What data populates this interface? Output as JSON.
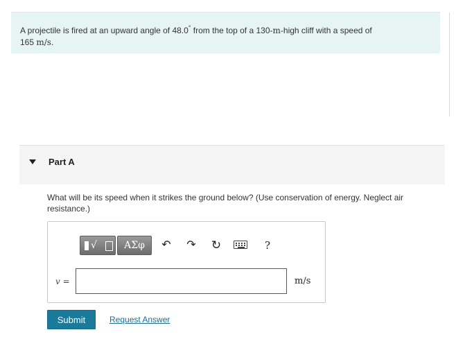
{
  "problem": {
    "text_1": "A projectile is fired at an upward angle of 48.0",
    "degree": "°",
    "text_2": " from the top of a 130-",
    "unit_m": "m",
    "text_3": "-high cliff with a speed of",
    "speed_value": "165",
    "speed_unit": "m/s",
    "end": "."
  },
  "part": {
    "title": "Part A",
    "question": "What will be its speed when it strikes the ground below? (Use conservation of energy. Neglect air resistance.)"
  },
  "toolbar": {
    "template_icon": "radical-template-icon",
    "greek_label": "ΑΣφ",
    "undo_icon": "undo-icon",
    "redo_icon": "redo-icon",
    "reset_icon": "reset-icon",
    "keyboard_icon": "keyboard-icon",
    "help_label": "?"
  },
  "answer": {
    "variable_label": "v =",
    "value": "",
    "unit": "m/s"
  },
  "actions": {
    "submit_label": "Submit",
    "request_answer_label": "Request Answer"
  },
  "colors": {
    "problem_bg": "#e6f4f4",
    "accent": "#1b7a9a",
    "link": "#1b6e93"
  }
}
